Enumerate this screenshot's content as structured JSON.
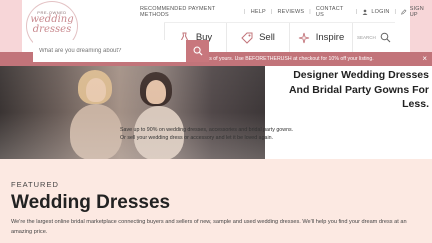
{
  "brand": {
    "logo_top": "PRE-OWNED",
    "logo_line1": "wedding",
    "logo_line2": "dresses",
    "logo_bottom": ".COM",
    "accent_color": "#c2747a",
    "gutter_color": "#f7d6d8"
  },
  "topnav": {
    "recommended": "RECOMMENDED PAYMENT METHODS",
    "help": "HELP",
    "reviews": "REVIEWS",
    "contact": "CONTACT US",
    "login": "LOGIN",
    "signup": "SIGN UP"
  },
  "mainnav": {
    "buy": "Buy",
    "sell": "Sell",
    "inspire": "Inspire",
    "search_label": "SEARCH"
  },
  "promo": {
    "text": "Don't miss one of the busiest months for selling that wedding dress of yours. Use BEFORETHERUSH at checkout for 10% off your listing.",
    "close": "×"
  },
  "hero": {
    "headline_line1": "Designer Wedding Dresses",
    "headline_line2": "And Bridal Party Gowns For",
    "headline_line3": "Less.",
    "search_placeholder": "What are you dreaming about?",
    "copy_line1": "Save up to 90% on wedding dresses, accessories and bridal party gowns.",
    "copy_line2": "Or sell your wedding dress or accessory and let it be loved again."
  },
  "featured": {
    "label": "FEATURED",
    "title": "Wedding Dresses",
    "description": "We're the largest online bridal marketplace connecting buyers and sellers of new, sample and used wedding dresses. We'll help you find your dream dress at an amazing price."
  }
}
